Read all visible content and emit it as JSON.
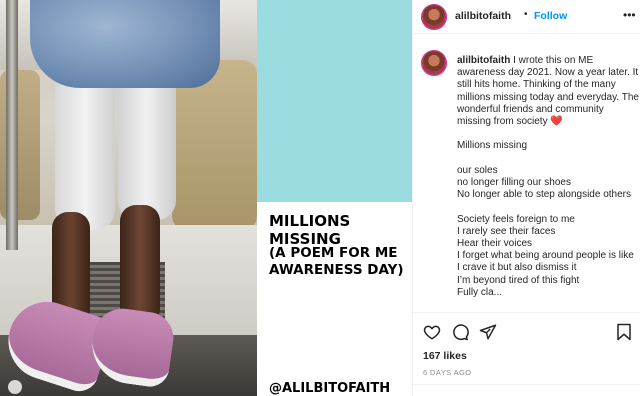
{
  "post": {
    "username": "alilbitofaith",
    "follow_label": "Follow",
    "separator": "•",
    "more_icon": "more-horizontal-icon"
  },
  "image_text": {
    "title": "MILLIONS MISSING",
    "subtitle": "(A POEM FOR ME\nAWARENESS DAY)",
    "handle": "@ALILBITOFAITH"
  },
  "caption": {
    "username": "alilbitofaith",
    "intro": "I wrote this on ME awareness day 2021. Now a year later. It still hits home. Thinking of the many millions missing today and everyday. The wonderful friends and community missing from society",
    "intro_emoji": "❤️",
    "heading": "Millions missing",
    "stanza1": [
      "our soles",
      "no longer filling our shoes",
      "No longer able to step alongside others"
    ],
    "stanza2": [
      "Society feels foreign to me",
      "I rarely see their faces",
      "Hear their voices",
      "I forget what being around people is like",
      "I crave it but also dismiss it",
      "I’m beyond tired of this fight",
      "Fully cla..."
    ]
  },
  "actions": {
    "icons": [
      "heart-icon",
      "comment-icon",
      "share-icon",
      "bookmark-icon"
    ]
  },
  "likes": "167 likes",
  "timestamp": "6 DAYS AGO",
  "colors": {
    "teal_block": "#9adcdf",
    "follow_blue": "#0095f6",
    "text": "#262626",
    "muted": "#8e8e8e"
  }
}
